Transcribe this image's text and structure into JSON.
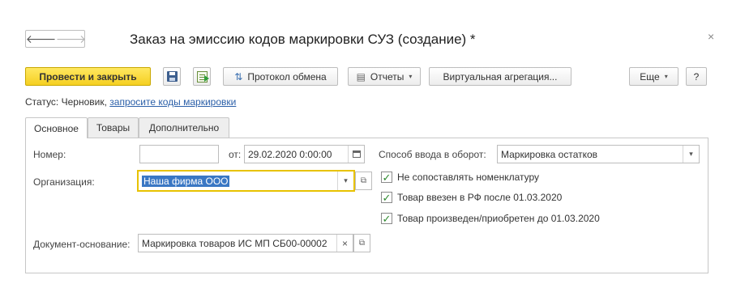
{
  "window": {
    "title": "Заказ на эмиссию кодов маркировки СУЗ (создание) *",
    "back_glyph": "🡐",
    "forward_glyph": "🡒",
    "close_glyph": "×"
  },
  "toolbar": {
    "post_close_label": "Провести и закрыть",
    "exchange_log_label": "Протокол обмена",
    "reports_label": "Отчеты",
    "virtual_aggregation_label": "Виртуальная агрегация...",
    "more_label": "Еще",
    "help_label": "?",
    "caret": "▾"
  },
  "status": {
    "prefix": "Статус:",
    "value": "Черновик,",
    "link": "запросите коды маркировки"
  },
  "tabs": [
    {
      "label": "Основное",
      "active": true
    },
    {
      "label": "Товары",
      "active": false
    },
    {
      "label": "Дополнительно",
      "active": false
    }
  ],
  "form": {
    "number_label": "Номер:",
    "number_value": "",
    "date_label": "от:",
    "date_value": "29.02.2020  0:00:00",
    "organization_label": "Организация:",
    "organization_value": "Наша фирма ООО",
    "basis_label": "Документ-основание:",
    "basis_value": "Маркировка товаров ИС МП СБ00-00002",
    "circulation_label": "Способ ввода в оборот:",
    "circulation_value": "Маркировка остатков",
    "checkboxes": [
      {
        "label": "Не сопоставлять номенклатуру",
        "checked": true
      },
      {
        "label": "Товар ввезен в РФ после 01.03.2020",
        "checked": true
      },
      {
        "label": "Товар произведен/приобретен до 01.03.2020",
        "checked": true
      }
    ],
    "clear_glyph": "×",
    "open_glyph": "⧉",
    "check_glyph": "✓"
  },
  "colors": {
    "primary_button": "#f5cf21",
    "link": "#2b5fa8",
    "selection": "#3a77c4",
    "checkmark": "#2f8a2f"
  }
}
